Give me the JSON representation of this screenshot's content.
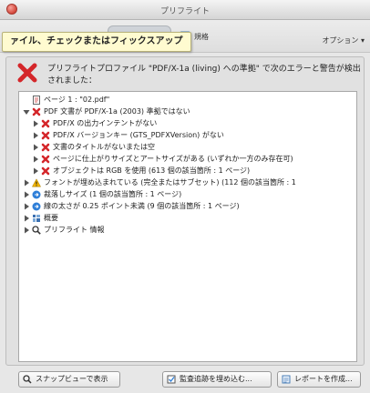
{
  "window": {
    "title": "プリフライト"
  },
  "toolbar": {
    "tooltip": "ァイル、チェックまたはフィックスアップ",
    "spec_label": "規格",
    "options_label": "オプション ▾"
  },
  "summary": {
    "text": "プリフライトプロファイル \"PDF/X-1a (living) への準拠\" で次のエラーと警告が検出されました："
  },
  "tree": {
    "rows": [
      {
        "indent": 0,
        "expander": "none",
        "icon": "page-icon",
        "label": "ページ 1 : \"02.pdf\""
      },
      {
        "indent": 0,
        "expander": "expanded",
        "icon": "error-icon",
        "label": "PDF 文書が PDF/X-1a (2003) 準拠ではない"
      },
      {
        "indent": 1,
        "expander": "collapsed",
        "icon": "error-icon",
        "label": "PDF/X の出力インテントがない"
      },
      {
        "indent": 1,
        "expander": "collapsed",
        "icon": "error-icon",
        "label": "PDF/X バージョンキー (GTS_PDFXVersion) がない"
      },
      {
        "indent": 1,
        "expander": "collapsed",
        "icon": "error-icon",
        "label": "文書のタイトルがないまたは空"
      },
      {
        "indent": 1,
        "expander": "collapsed",
        "icon": "error-icon",
        "label": "ページに仕上がりサイズとアートサイズがある (いずれか一方のみ存在可)"
      },
      {
        "indent": 1,
        "expander": "collapsed",
        "icon": "error-icon",
        "label": "オブジェクトは RGB を使用 (613 個の該当箇所 : 1 ページ)"
      },
      {
        "indent": 0,
        "expander": "collapsed",
        "icon": "warning-icon",
        "label": "フォントが埋め込まれている (完全またはサブセット) (112 個の該当箇所 : 1"
      },
      {
        "indent": 0,
        "expander": "collapsed",
        "icon": "info-icon",
        "label": "裁落しサイズ (1 個の該当箇所 : 1 ページ)"
      },
      {
        "indent": 0,
        "expander": "collapsed",
        "icon": "info-icon",
        "label": "線の太さが 0.25 ポイント未満 (9 個の該当箇所 : 1 ページ)"
      },
      {
        "indent": 0,
        "expander": "collapsed",
        "icon": "overview-icon",
        "label": "概要"
      },
      {
        "indent": 0,
        "expander": "collapsed",
        "icon": "preflight-info-icon",
        "label": "プリフライト 情報"
      }
    ]
  },
  "buttons": {
    "snap_view": "スナップビューで表示",
    "embed_audit": "監査追跡を埋め込む...",
    "create_report": "レポートを作成..."
  },
  "colors": {
    "error": "#d4262a",
    "warning": "#f1b400",
    "info": "#2f7fd8",
    "tooltip_bg": "#fffbd0"
  }
}
